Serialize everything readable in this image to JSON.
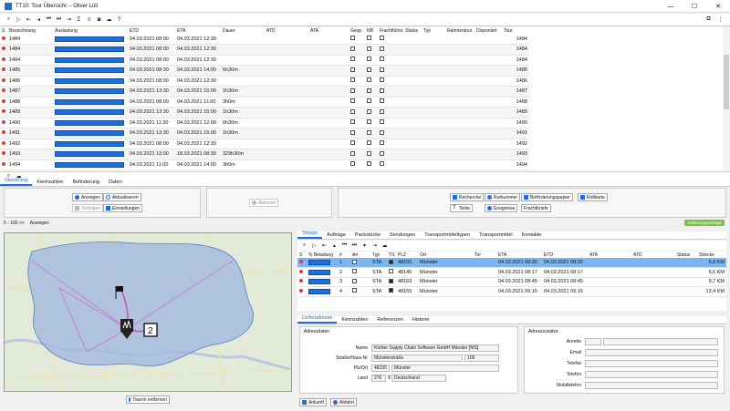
{
  "window": {
    "title": "TT10: Tour Übersicht -- Oliver Lüll",
    "minimize": "—",
    "maximize": "☐",
    "close": "✕"
  },
  "columns": [
    "S",
    "Bezeichnung",
    "Auslastung",
    "ETD",
    "ETA",
    "Dauer",
    "ATD",
    "ATA",
    "Gesp.",
    "NB",
    "Frachtführer",
    "Status",
    "Typ",
    "Rahmentour",
    "Disponiert",
    "Tour"
  ],
  "tours": [
    {
      "id": "1484",
      "load": 0.98,
      "etd": "04.03.2021 08:00",
      "eta": "04.03.2021 12:30",
      "dauer": "",
      "gesp": false,
      "nb": false,
      "ff": false,
      "tour": "1484"
    },
    {
      "id": "1484",
      "load": 0.98,
      "etd": "04.03.2021 08:00",
      "eta": "04.03.2021 12:30",
      "dauer": "",
      "gesp": false,
      "nb": false,
      "ff": false,
      "tour": "1484"
    },
    {
      "id": "1484",
      "load": 0.98,
      "etd": "04.03.2021 08:00",
      "eta": "04.03.2021 12:30",
      "dauer": "",
      "gesp": false,
      "nb": false,
      "ff": false,
      "tour": "1484"
    },
    {
      "id": "1485",
      "load": 0.98,
      "etd": "04.03.2021 08:30",
      "eta": "04.03.2021 14:00",
      "dauer": "5h30m",
      "gesp": false,
      "nb": false,
      "ff": false,
      "tour": "1485"
    },
    {
      "id": "1486",
      "load": 0.98,
      "etd": "04.03.2021 08:00",
      "eta": "04.03.2021 12:30",
      "dauer": "",
      "gesp": false,
      "nb": false,
      "ff": false,
      "tour": "1486"
    },
    {
      "id": "1487",
      "load": 0.98,
      "etd": "04.03.2021 13:30",
      "eta": "04.03.2021 15:00",
      "dauer": "1h30m",
      "gesp": false,
      "nb": false,
      "ff": false,
      "tour": "1487"
    },
    {
      "id": "1488",
      "load": 0.98,
      "etd": "04.03.2021 08:00",
      "eta": "04.03.2021 11:00",
      "dauer": "3h0m",
      "gesp": false,
      "nb": false,
      "ff": false,
      "tour": "1488"
    },
    {
      "id": "1489",
      "load": 0.98,
      "etd": "04.03.2021 13:30",
      "eta": "04.03.2021 15:00",
      "dauer": "1h30m",
      "gesp": false,
      "nb": false,
      "ff": false,
      "tour": "1489"
    },
    {
      "id": "1490",
      "load": 0.98,
      "etd": "04.03.2021 11:30",
      "eta": "04.03.2021 12:00",
      "dauer": "0h30m",
      "gesp": false,
      "nb": false,
      "ff": false,
      "tour": "1490"
    },
    {
      "id": "1491",
      "load": 0.98,
      "etd": "04.03.2021 13:30",
      "eta": "04.03.2021 15:00",
      "dauer": "1h30m",
      "gesp": false,
      "nb": false,
      "ff": false,
      "tour": "1491"
    },
    {
      "id": "1492",
      "load": 0.98,
      "etd": "04.03.2021 08:00",
      "eta": "04.03.2021 12:30",
      "dauer": "",
      "gesp": false,
      "nb": false,
      "ff": false,
      "tour": "1492"
    },
    {
      "id": "1493",
      "load": 0.98,
      "etd": "04.03.2021 13:00",
      "eta": "18.03.2021 08:30",
      "dauer": "329h30m",
      "gesp": false,
      "nb": false,
      "ff": false,
      "tour": "1493"
    },
    {
      "id": "1494",
      "load": 0.98,
      "etd": "04.03.2021 11:00",
      "eta": "04.03.2021 14:00",
      "dauer": "3h0m",
      "gesp": false,
      "nb": false,
      "ff": false,
      "tour": "1494"
    }
  ],
  "main_tabs": [
    "Steuerung",
    "Kennzahlen",
    "Befinderung",
    "Daten"
  ],
  "actions": {
    "anzeigen": "Anzeigen",
    "aktualisieren": "Aktualisieren",
    "verfolgen": "Verfolgen",
    "einstellungen": "Einstellungen",
    "aktionen": "Aktionen",
    "recherche": "Recherche",
    "rufnummer": "Rufnummer",
    "befoerderungspapier": "Beförderungspapier",
    "rollkarte": "Rollkarte",
    "texte": "Texte",
    "ereignisse": "Ereignisse",
    "frachtbriefe": "Frachtbriefe"
  },
  "status_line": {
    "range": "5 - 100 >>",
    "label": "Anzeigen",
    "badge": "Änderungsanzeige"
  },
  "map": {
    "button": "Touren entfernen",
    "marker_label": "2"
  },
  "stop_tabs": [
    "Stopps",
    "Aufträge",
    "Packstücke",
    "Sendungen",
    "Transportmitteltypen",
    "Transportmittel",
    "Kontakte"
  ],
  "stop_columns": [
    "S",
    "% Beladung",
    "#",
    "Art",
    "Typ",
    "T/L",
    "PLZ",
    "Ort",
    "Tor",
    "ETA",
    "ETD",
    "ATA",
    "ATD",
    "Status",
    "Strecke"
  ],
  "stops": [
    {
      "nr": "1",
      "art": "STA",
      "tl": true,
      "plz": "48155",
      "ort": "Münster",
      "eta": "04.03.2021 08:30",
      "etd": "04.03.2021 08:30",
      "strecke": "6,8",
      "unit": "KM",
      "sel": true
    },
    {
      "nr": "2",
      "art": "STA",
      "tl": false,
      "plz": "48145",
      "ort": "Münster",
      "eta": "04.03.2021 08:17",
      "etd": "04.03.2021 08:17",
      "strecke": "6,6",
      "unit": "KM",
      "sel": false
    },
    {
      "nr": "3",
      "art": "STA",
      "tl": true,
      "plz": "48163",
      "ort": "Münster",
      "eta": "04.03.2021 08:45",
      "etd": "04.03.2021 08:45",
      "strecke": "9,7",
      "unit": "KM",
      "sel": false
    },
    {
      "nr": "4",
      "art": "STA",
      "tl": true,
      "plz": "48155",
      "ort": "Münster",
      "eta": "04.03.2021 09:15",
      "etd": "04.03.2021 09:15",
      "strecke": "13,4",
      "unit": "KM",
      "sel": false
    }
  ],
  "lower_tabs": [
    "Lieferadresse",
    "Kennzahlen",
    "Referenzen",
    "Historie"
  ],
  "address": {
    "caption": "Adressdaten",
    "name_label": "Name",
    "name": "Körber Supply Chain Software GmbH Münster [MS]",
    "street_label": "Straße/Haus-Nr",
    "street": "Münsterstraße",
    "house": "109",
    "plz_label": "Plz/Ort",
    "plz": "48155",
    "ort": "Münster",
    "land_label": "Land",
    "land_code": "276",
    "land": "Deutschland"
  },
  "contact": {
    "caption": "Adresszusätze",
    "anrede": "Anrede",
    "email": "Email",
    "telefax": "Telefax",
    "telefon": "Telefon",
    "mobil": "Mobiltelefon"
  },
  "footer": {
    "ankunft": "Ankunft",
    "abfahrt": "Abfahrt"
  },
  "colors": {
    "accent": "#1e6fd9",
    "status_red": "#e53935",
    "badge_green": "#7cc043",
    "selected_row": "#7ab6ef",
    "map_region": "#9fb6e0",
    "route": "#d64cc4"
  }
}
